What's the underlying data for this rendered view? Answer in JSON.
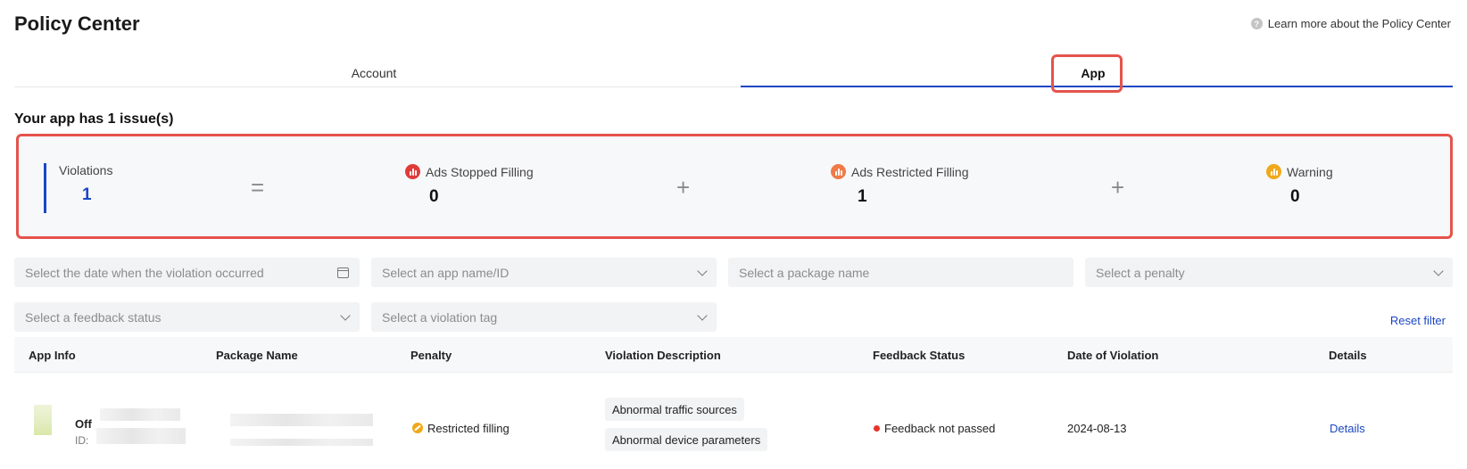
{
  "header": {
    "title": "Policy Center",
    "learn_more": "Learn more about the Policy Center"
  },
  "tabs": [
    {
      "label": "Account",
      "active": false
    },
    {
      "label": "App",
      "active": true
    }
  ],
  "summary": {
    "title": "Your app has 1 issue(s)",
    "violations": {
      "label": "Violations",
      "value": "1"
    },
    "equals": "=",
    "plus": "+",
    "ads_stopped": {
      "label": "Ads Stopped Filling",
      "value": "0",
      "color": "#e03b3b"
    },
    "ads_restricted": {
      "label": "Ads Restricted Filling",
      "value": "1",
      "color": "#f07a47"
    },
    "warning": {
      "label": "Warning",
      "value": "0",
      "color": "#f0a91a"
    }
  },
  "filters": {
    "date": "Select the date when the violation occurred",
    "app": "Select an app name/ID",
    "package": "Select a package name",
    "penalty": "Select a penalty",
    "feedback": "Select a feedback status",
    "tag": "Select a violation tag",
    "reset": "Reset filter"
  },
  "table": {
    "columns": [
      "App Info",
      "Package Name",
      "Penalty",
      "Violation Description",
      "Feedback Status",
      "Date of Violation",
      "Details"
    ],
    "rows": [
      {
        "app_name": "Off",
        "app_id_label": "ID:",
        "penalty": "Restricted filling",
        "violations": [
          "Abnormal traffic sources",
          "Abnormal device parameters"
        ],
        "feedback": "Feedback not passed",
        "date": "2024-08-13",
        "details": "Details"
      }
    ]
  },
  "colors": {
    "accent": "#1b46c4",
    "highlight": "#e5534b",
    "status_failed": "#e5342a"
  }
}
